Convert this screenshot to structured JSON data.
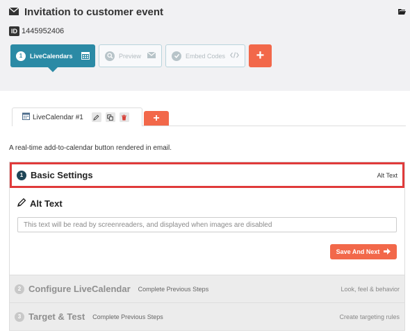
{
  "header": {
    "title": "Invitation to customer event",
    "id_badge": "ID",
    "id_value": "1445952406"
  },
  "wizard": {
    "steps": [
      {
        "number": "1",
        "label": "LiveCalendars",
        "icon": "calendar-icon"
      },
      {
        "number": "",
        "label": "Preview",
        "icon": "envelope-icon"
      },
      {
        "number": "",
        "label": "Embed Codes",
        "icon": "code-icon"
      }
    ],
    "add_label": "+"
  },
  "tabs": {
    "items": [
      {
        "label": "LiveCalendar #1"
      }
    ],
    "add_label": "+"
  },
  "description": "A real-time add-to-calendar button rendered in email.",
  "sections": {
    "basic": {
      "number": "1",
      "label": "Basic Settings",
      "right": "Alt Text"
    },
    "alt_text": {
      "title": "Alt Text",
      "placeholder": "This text will be read by screenreaders, and displayed when images are disabled",
      "save_label": "Save And Next"
    },
    "configure": {
      "number": "2",
      "label": "Configure LiveCalendar",
      "sub": "Complete Previous Steps",
      "right": "Look, feel & behavior"
    },
    "target": {
      "number": "3",
      "label": "Target & Test",
      "sub": "Complete Previous Steps",
      "right": "Create targeting rules"
    }
  },
  "colors": {
    "accent": "#2b8aa5",
    "action": "#f2684a",
    "highlight": "#e03a3a"
  }
}
